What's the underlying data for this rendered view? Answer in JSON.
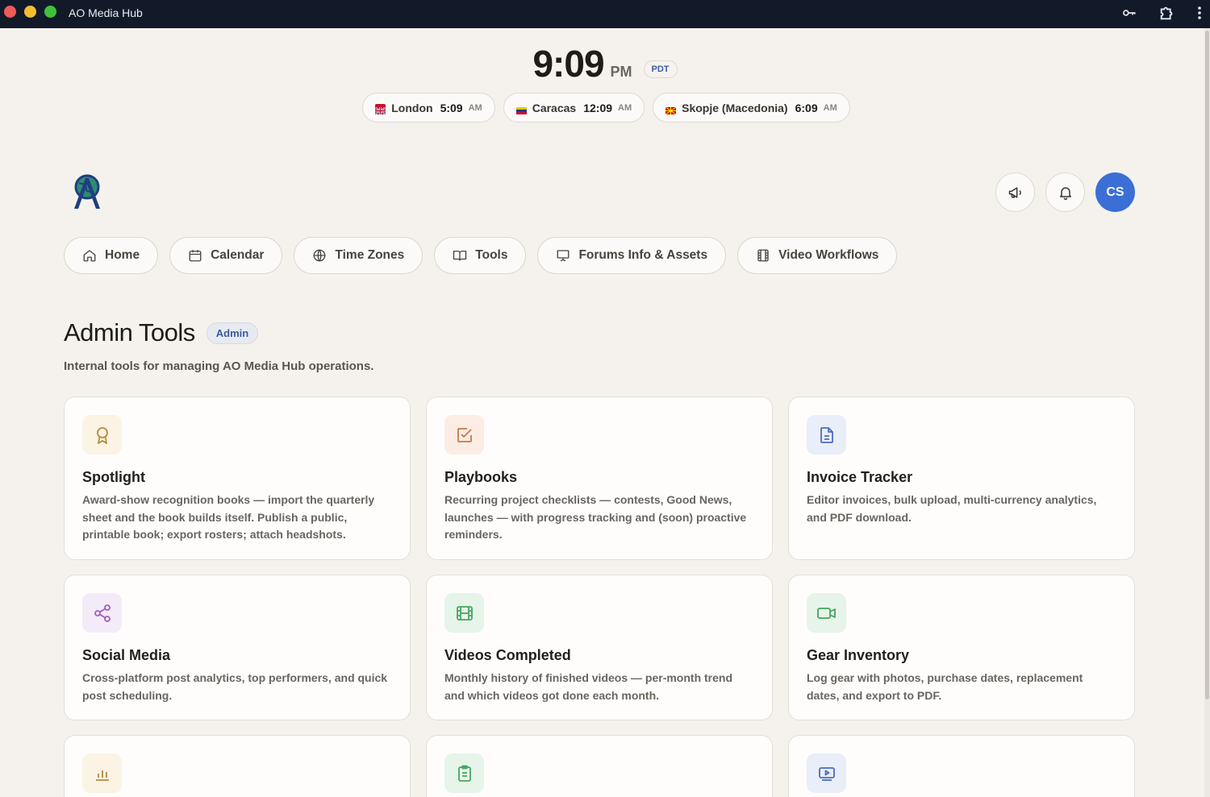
{
  "window": {
    "title": "AO Media Hub"
  },
  "titlebar_icons": [
    "key-icon",
    "extension-icon",
    "more-vertical-icon"
  ],
  "clock": {
    "time": "9:09",
    "ampm": "PM",
    "timezone": "PDT"
  },
  "zones": [
    {
      "city": "London",
      "time": "5:09",
      "ampm": "AM",
      "flag": "uk-flag-icon"
    },
    {
      "city": "Caracas",
      "time": "12:09",
      "ampm": "AM",
      "flag": "venezuela-flag-icon"
    },
    {
      "city": "Skopje (Macedonia)",
      "time": "6:09",
      "ampm": "AM",
      "flag": "north-macedonia-flag-icon"
    }
  ],
  "header": {
    "avatar_initials": "CS"
  },
  "nav": [
    {
      "label": "Home",
      "icon": "home-icon"
    },
    {
      "label": "Calendar",
      "icon": "calendar-icon"
    },
    {
      "label": "Time Zones",
      "icon": "globe-icon"
    },
    {
      "label": "Tools",
      "icon": "book-open-icon"
    },
    {
      "label": "Forums Info & Assets",
      "icon": "presentation-icon"
    },
    {
      "label": "Video Workflows",
      "icon": "film-icon"
    }
  ],
  "page": {
    "title": "Admin Tools",
    "badge": "Admin",
    "subtitle": "Internal tools for managing AO Media Hub operations."
  },
  "cards": [
    {
      "title": "Spotlight",
      "description": "Award-show recognition books — import the quarterly sheet and the book builds itself. Publish a public, printable book; export rosters; attach headshots.",
      "icon": "award-icon"
    },
    {
      "title": "Playbooks",
      "description": "Recurring project checklists — contests, Good News, launches — with progress tracking and (soon) proactive reminders.",
      "icon": "checkbox-icon"
    },
    {
      "title": "Invoice Tracker",
      "description": "Editor invoices, bulk upload, multi-currency analytics, and PDF download.",
      "icon": "file-text-icon"
    },
    {
      "title": "Social Media",
      "description": "Cross-platform post analytics, top performers, and quick post scheduling.",
      "icon": "share-icon"
    },
    {
      "title": "Videos Completed",
      "description": "Monthly history of finished videos — per-month trend and which videos got done each month.",
      "icon": "film-strip-icon"
    },
    {
      "title": "Gear Inventory",
      "description": "Log gear with photos, purchase dates, replacement dates, and export to PDF.",
      "icon": "video-camera-icon"
    },
    {
      "title": "",
      "description": "",
      "icon": "bar-chart-icon"
    },
    {
      "title": "",
      "description": "",
      "icon": "clipboard-icon"
    },
    {
      "title": "",
      "description": "",
      "icon": "video-play-icon"
    }
  ],
  "colors": {
    "accent": "#3b6fd6",
    "titlebar": "#121a2a",
    "background": "#f5f2ee"
  }
}
